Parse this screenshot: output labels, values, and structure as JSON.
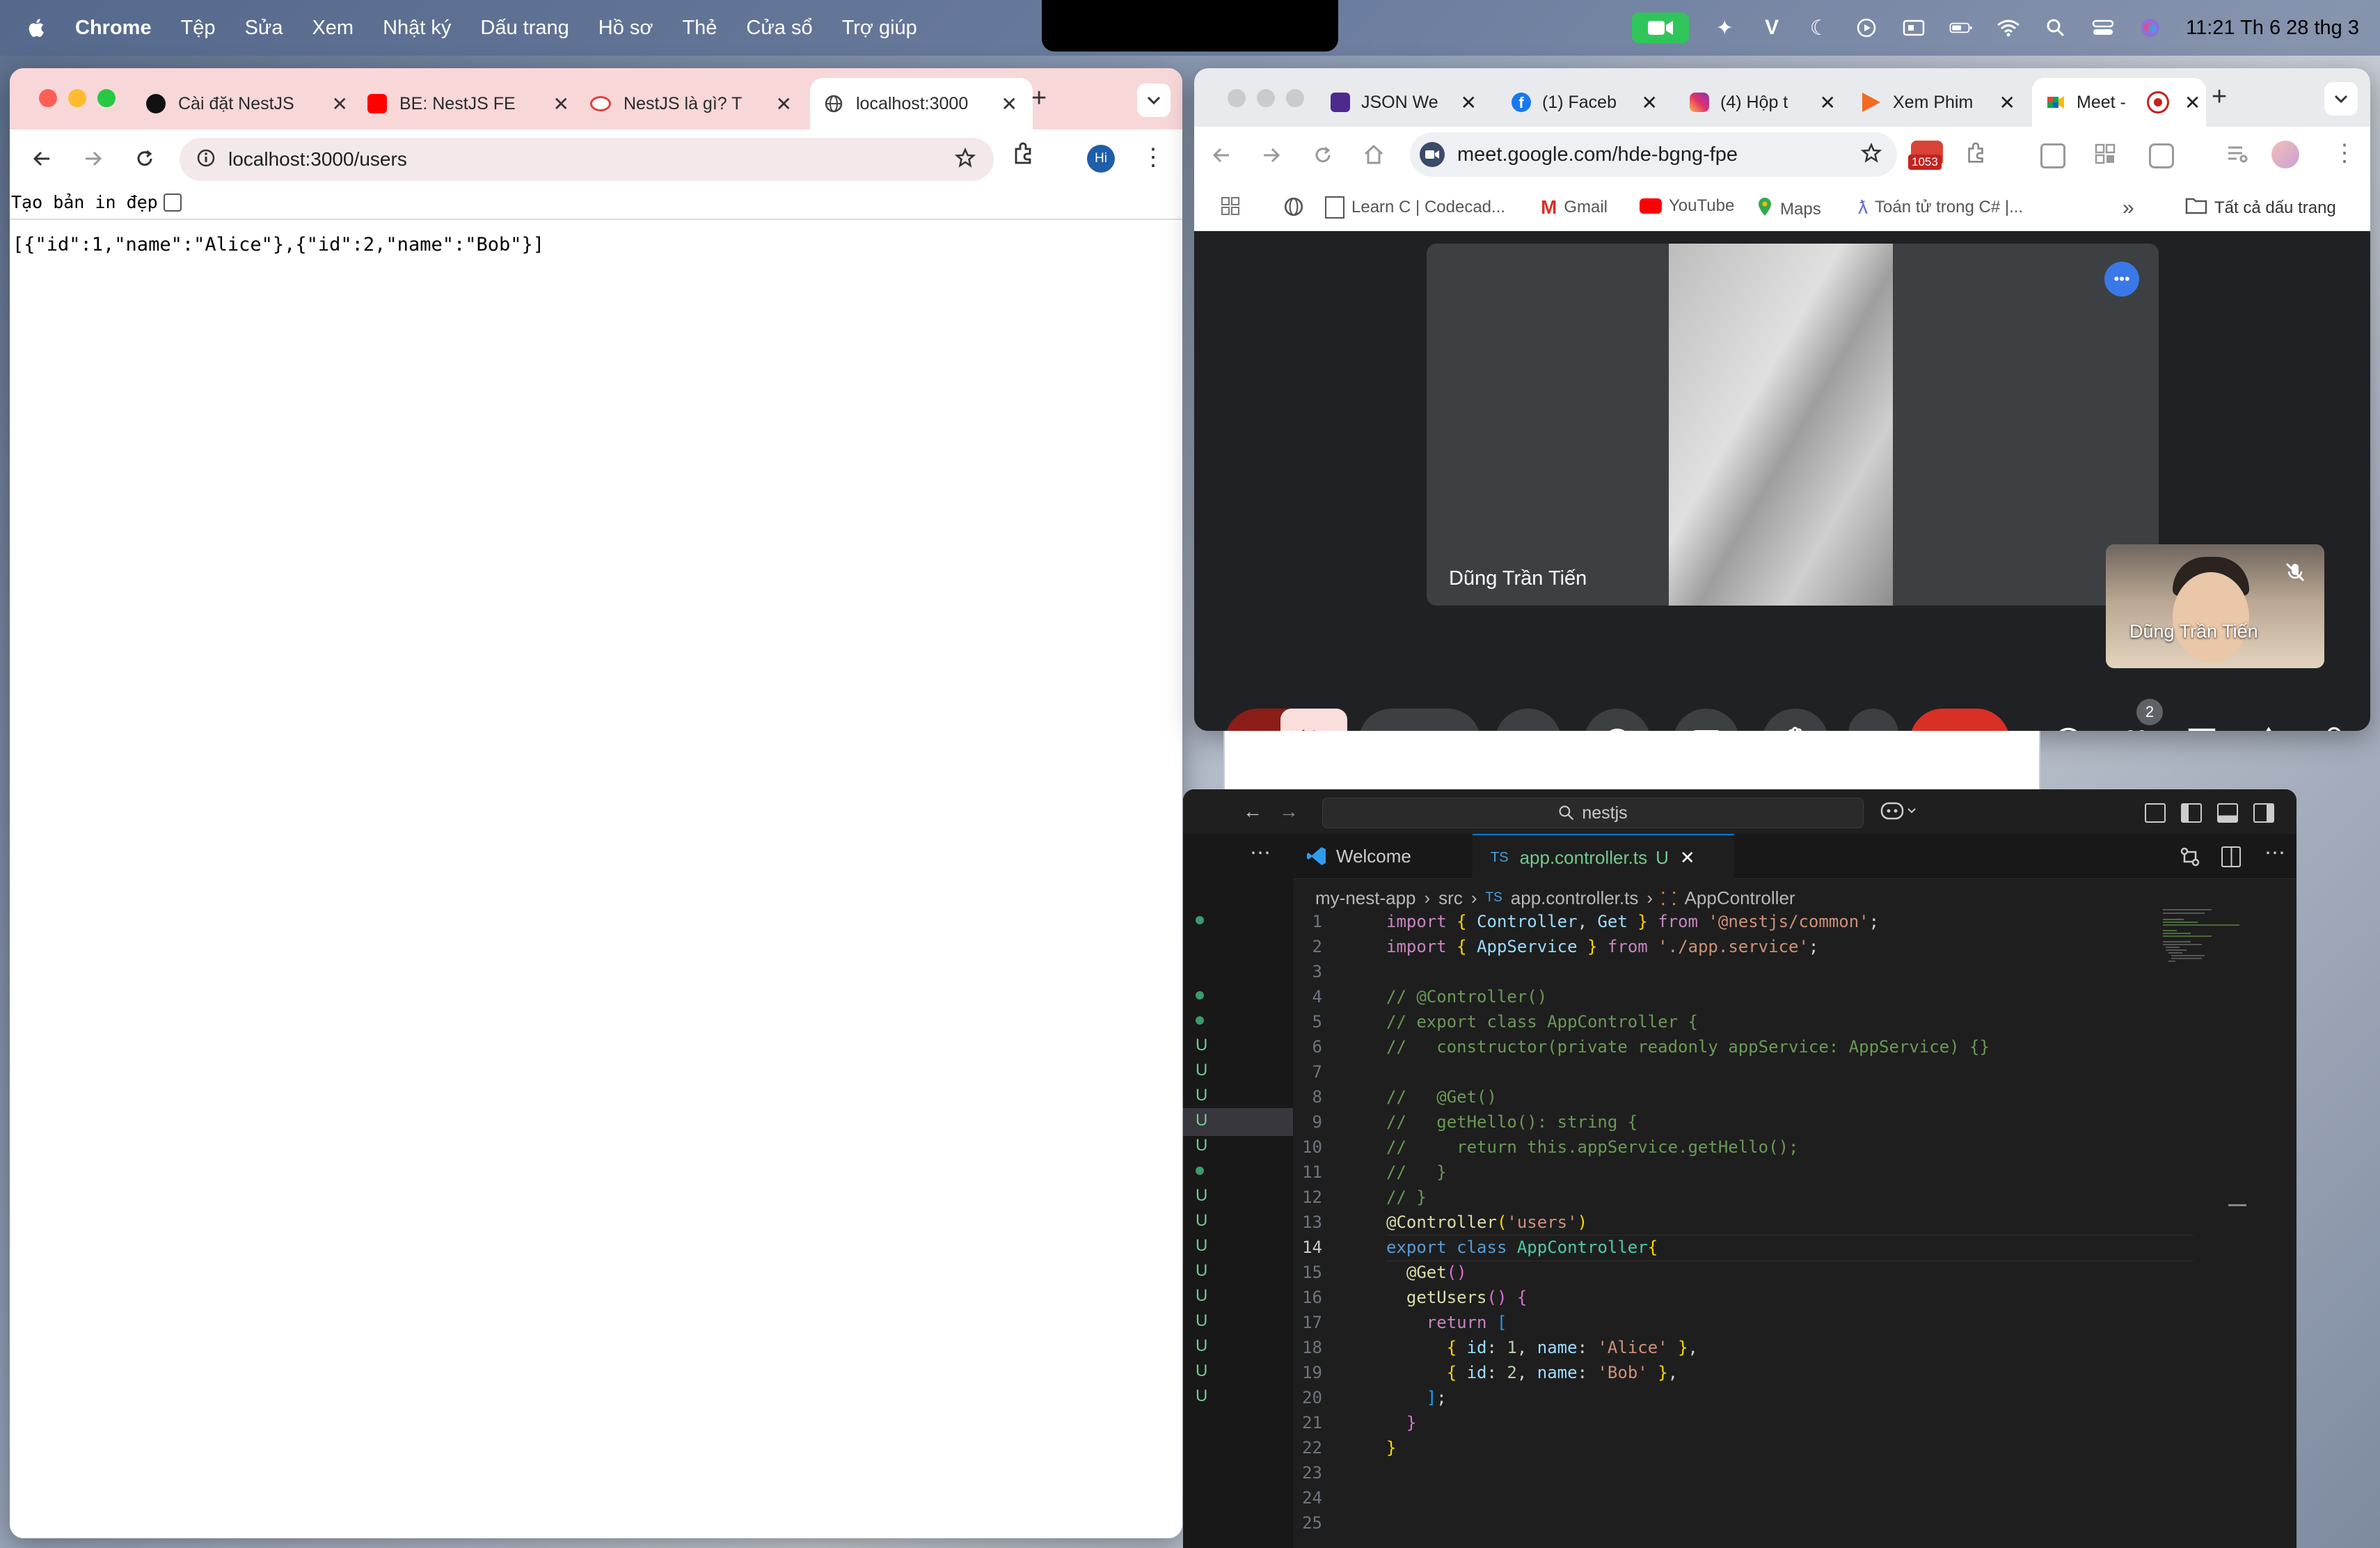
{
  "menubar": {
    "app": "Chrome",
    "items": [
      "Tệp",
      "Sửa",
      "Xem",
      "Nhật ký",
      "Dấu trang",
      "Hồ sơ",
      "Thẻ",
      "Cửa sổ",
      "Trợ giúp"
    ],
    "clock": "11:21 Th 6 28 thg 3"
  },
  "left_browser": {
    "tabs": [
      {
        "title": "Cài đặt NestJS",
        "icon": "openai-icon"
      },
      {
        "title": "BE: NestJS FE",
        "icon": "youtube-icon"
      },
      {
        "title": "NestJS là gì? T",
        "icon": "site-icon"
      },
      {
        "title": "localhost:3000",
        "icon": "globe-icon",
        "active": true
      }
    ],
    "url": "localhost:3000/users",
    "profile": "Hi",
    "pretty_print_label": "Tạo bản in đẹp",
    "json_body": "[{\"id\":1,\"name\":\"Alice\"},{\"id\":2,\"name\":\"Bob\"}]"
  },
  "meet_browser": {
    "tabs": [
      {
        "title": "JSON We",
        "icon": "json-icon"
      },
      {
        "title": "(1) Faceb",
        "icon": "facebook-icon"
      },
      {
        "title": "(4) Hộp t",
        "icon": "instagram-icon"
      },
      {
        "title": "Xem Phim",
        "icon": "film-icon"
      },
      {
        "title": "Meet -",
        "icon": "meet-icon",
        "active": true
      }
    ],
    "url": "meet.google.com/hde-bgng-fpe",
    "extension_badge": "1053",
    "bookmarks": [
      "Learn C | Codecad...",
      "Gmail",
      "YouTube",
      "Maps",
      "Toán tử trong C# |..."
    ],
    "bookmarks_more": "»",
    "all_bookmarks": "Tất cả dấu trang",
    "main_participant": "Dũng Trần Tiến",
    "self_participant": "Dũng Trần Tiến",
    "people_count": "2",
    "colors": {
      "end_call": "#d93025",
      "mic_off": "#f9dedc",
      "more": "#3b78e7"
    }
  },
  "vscode": {
    "search": "nestjs",
    "tabs": [
      {
        "label": "Welcome",
        "icon": "vscode-icon"
      },
      {
        "prefix": "TS",
        "label": "app.controller.ts",
        "status": "U",
        "active": true
      }
    ],
    "breadcrumb": [
      "my-nest-app",
      "src",
      "TS",
      "app.controller.ts",
      "AppController"
    ],
    "active_line": "14",
    "gutter_marks": [
      "•",
      "",
      "",
      "•",
      "•",
      "U",
      "U",
      "U",
      "U",
      "U",
      "•",
      "U",
      "U",
      "U",
      "U",
      "U",
      "U",
      "U",
      "U",
      "U"
    ],
    "lines": [
      "1",
      "2",
      "3",
      "4",
      "5",
      "6",
      "7",
      "8",
      "9",
      "10",
      "11",
      "12",
      "13",
      "14",
      "15",
      "16",
      "17",
      "18",
      "19",
      "20",
      "21",
      "22",
      "23",
      "24",
      "25"
    ]
  }
}
